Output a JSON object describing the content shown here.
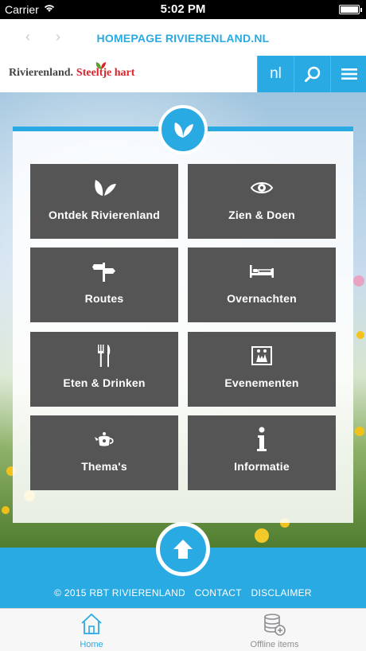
{
  "status_bar": {
    "carrier": "Carrier",
    "time": "5:02 PM"
  },
  "nav": {
    "back_glyph": "‹",
    "forward_glyph": "›",
    "title": "HOMEPAGE RIVIERENLAND.NL"
  },
  "header": {
    "logo_brand": "Rivierenland.",
    "logo_tag": "Steeltje hart",
    "lang_label": "nl",
    "icons": {
      "search": "search-icon",
      "menu": "hamburger-menu-icon"
    }
  },
  "tiles": [
    {
      "label": "Ontdek Rivierenland",
      "icon": "leaf-icon"
    },
    {
      "label": "Zien & Doen",
      "icon": "eye-icon"
    },
    {
      "label": "Routes",
      "icon": "signpost-icon"
    },
    {
      "label": "Overnachten",
      "icon": "bed-icon"
    },
    {
      "label": "Eten & Drinken",
      "icon": "cutlery-icon"
    },
    {
      "label": "Evenementen",
      "icon": "events-icon"
    },
    {
      "label": "Thema's",
      "icon": "teapot-icon"
    },
    {
      "label": "Informatie",
      "icon": "info-icon"
    }
  ],
  "footer": {
    "copyright": "© 2015 RBT RIVIERENLAND",
    "contact": "CONTACT",
    "disclaimer": "DISCLAIMER"
  },
  "tab_bar": {
    "home": "Home",
    "offline": "Offline items"
  },
  "colors": {
    "accent": "#2aaae2",
    "tile": "#555556",
    "logo_red": "#d8232a"
  }
}
